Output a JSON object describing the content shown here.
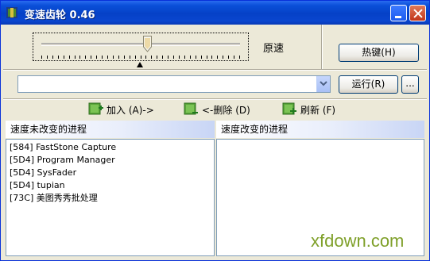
{
  "window": {
    "title": "变速齿轮 0.46"
  },
  "speed": {
    "label": "原速",
    "slider_position": 0.53,
    "tick_count": 37
  },
  "buttons": {
    "hotkey": "热键(H)",
    "run": "运行(R)",
    "more": "..."
  },
  "combo": {
    "value": ""
  },
  "actions": {
    "add": "加入 (A)->",
    "remove": "<-删除 (D)",
    "refresh": "刷新 (F)"
  },
  "lists": {
    "left_header": "速度未改变的进程",
    "right_header": "速度改变的进程",
    "left_items": [
      "[584] FastStone Capture",
      "[5D4] Program Manager",
      "[5D4] SysFader",
      "[5D4] tupian",
      "[73C] 美图秀秀批处理"
    ],
    "right_items": []
  },
  "watermark": "xfdown.com",
  "colors": {
    "titlebar": "#0541c7",
    "face": "#ece9d8",
    "icon_green": "#3aa33a"
  }
}
